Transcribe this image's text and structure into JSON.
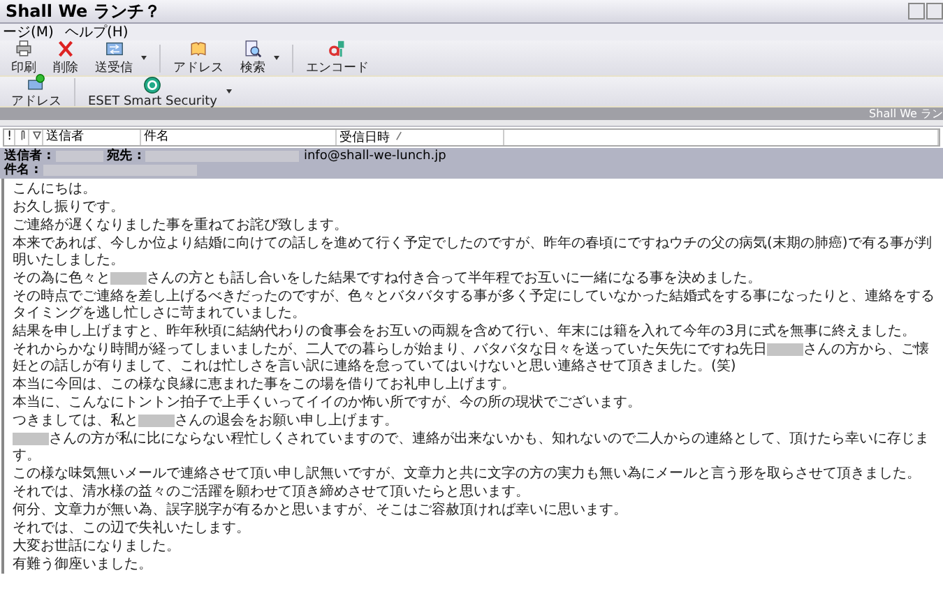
{
  "window": {
    "title": "Shall We ランチ？"
  },
  "menu": [
    "ージ(M)",
    "ヘルプ(H)"
  ],
  "toolbar": [
    {
      "label": "印刷",
      "kind": "printer",
      "dropdown": false
    },
    {
      "label": "削除",
      "kind": "delete",
      "dropdown": false
    },
    {
      "label": "送受信",
      "kind": "sendreceive",
      "dropdown": true
    },
    {
      "label": "アドレス",
      "kind": "book",
      "dropdown": false
    },
    {
      "label": "検索",
      "kind": "find",
      "dropdown": true
    },
    {
      "label": "エンコード",
      "kind": "encode",
      "dropdown": false
    }
  ],
  "toolbar2": [
    {
      "label": "アドレス",
      "kind": "address",
      "dropdown": false
    },
    {
      "label": "ESET Smart Security",
      "kind": "eset",
      "dropdown": true
    }
  ],
  "folder_bar": {
    "title": "Shall We ラン"
  },
  "columns": [
    {
      "label": "!",
      "kind": "icon"
    },
    {
      "kind": "attach"
    },
    {
      "kind": "flag"
    },
    {
      "label": "送信者",
      "kind": "text"
    },
    {
      "label": "件名",
      "kind": "text"
    },
    {
      "label": "受信日時",
      "kind": "sorted"
    }
  ],
  "message_header": {
    "from_label": "送信者 :",
    "to_label": "宛先 :",
    "to_address": "info@shall-we-lunch.jp",
    "subject_label": "件名 :"
  },
  "body": [
    [
      {
        "kind": "text",
        "text": "こんにちは。"
      }
    ],
    [
      {
        "kind": "text",
        "text": "お久し振りです。"
      }
    ],
    [
      {
        "kind": "text",
        "text": "ご連絡が遅くなりました事を重ねてお詫び致します。"
      }
    ],
    [
      {
        "kind": "text",
        "text": "本来であれば、今しか位より結婚に向けての話しを進めて行く予定でしたのですが、昨年の春頃にですねウチの父の病気(末期の肺癌)で有る事が判明いたしました。"
      }
    ],
    [
      {
        "kind": "text",
        "text": "その為に色々と"
      },
      {
        "kind": "redacted"
      },
      {
        "kind": "text",
        "text": "さんの方とも話し合いをした結果ですね付き合って半年程でお互いに一緒になる事を決めました。"
      }
    ],
    [
      {
        "kind": "text",
        "text": "その時点でご連絡を差し上げるべきだったのですが、色々とバタバタする事が多く予定にしていなかった結婚式をする事になったりと、連絡をするタイミングを逃し忙しさに苛まれていました。"
      }
    ],
    [
      {
        "kind": "text",
        "text": "結果を申し上げますと、昨年秋頃に結納代わりの食事会をお互いの両親を含めて行い、年末には籍を入れて今年の3月に式を無事に終えました。"
      }
    ],
    [
      {
        "kind": "text",
        "text": "それからかなり時間が経ってしまいましたが、二人での暮らしが始まり、バタバタな日々を送っていた矢先にですね先日"
      },
      {
        "kind": "redacted"
      },
      {
        "kind": "text",
        "text": "さんの方から、ご懐妊との話しが有りまして、これは忙しさを言い訳に連絡を怠っていてはいけないと思い連絡させて頂きました。(笑)"
      }
    ],
    [
      {
        "kind": "text",
        "text": "本当に今回は、この様な良縁に恵まれた事をこの場を借りてお礼申し上げます。"
      }
    ],
    [
      {
        "kind": "text",
        "text": "本当に、こんなにトントン拍子で上手くいってイイのか怖い所ですが、今の所の現状でございます。"
      }
    ],
    [
      {
        "kind": "text",
        "text": "つきましては、私と"
      },
      {
        "kind": "redacted"
      },
      {
        "kind": "text",
        "text": "さんの退会をお願い申し上げます。"
      }
    ],
    [
      {
        "kind": "redacted"
      },
      {
        "kind": "text",
        "text": "さんの方が私に比にならない程忙しくされていますので、連絡が出来ないかも、知れないので二人からの連絡として、頂けたら幸いに存じます。"
      }
    ],
    [
      {
        "kind": "text",
        "text": "この様な味気無いメールで連絡させて頂い申し訳無いですが、文章力と共に文字の方の実力も無い為にメールと言う形を取らさせて頂きました。"
      }
    ],
    [
      {
        "kind": "text",
        "text": "それでは、清水様の益々のご活躍を願わせて頂き締めさせて頂いたらと思います。"
      }
    ],
    [
      {
        "kind": "text",
        "text": "何分、文章力が無い為、誤字脱字が有るかと思いますが、そこはご容赦頂ければ幸いに思います。"
      }
    ],
    [
      {
        "kind": "text",
        "text": "それでは、この辺で失礼いたします。"
      }
    ],
    [
      {
        "kind": "text",
        "text": "大変お世話になりました。"
      }
    ],
    [
      {
        "kind": "text",
        "text": "有難う御座いました。"
      }
    ]
  ]
}
